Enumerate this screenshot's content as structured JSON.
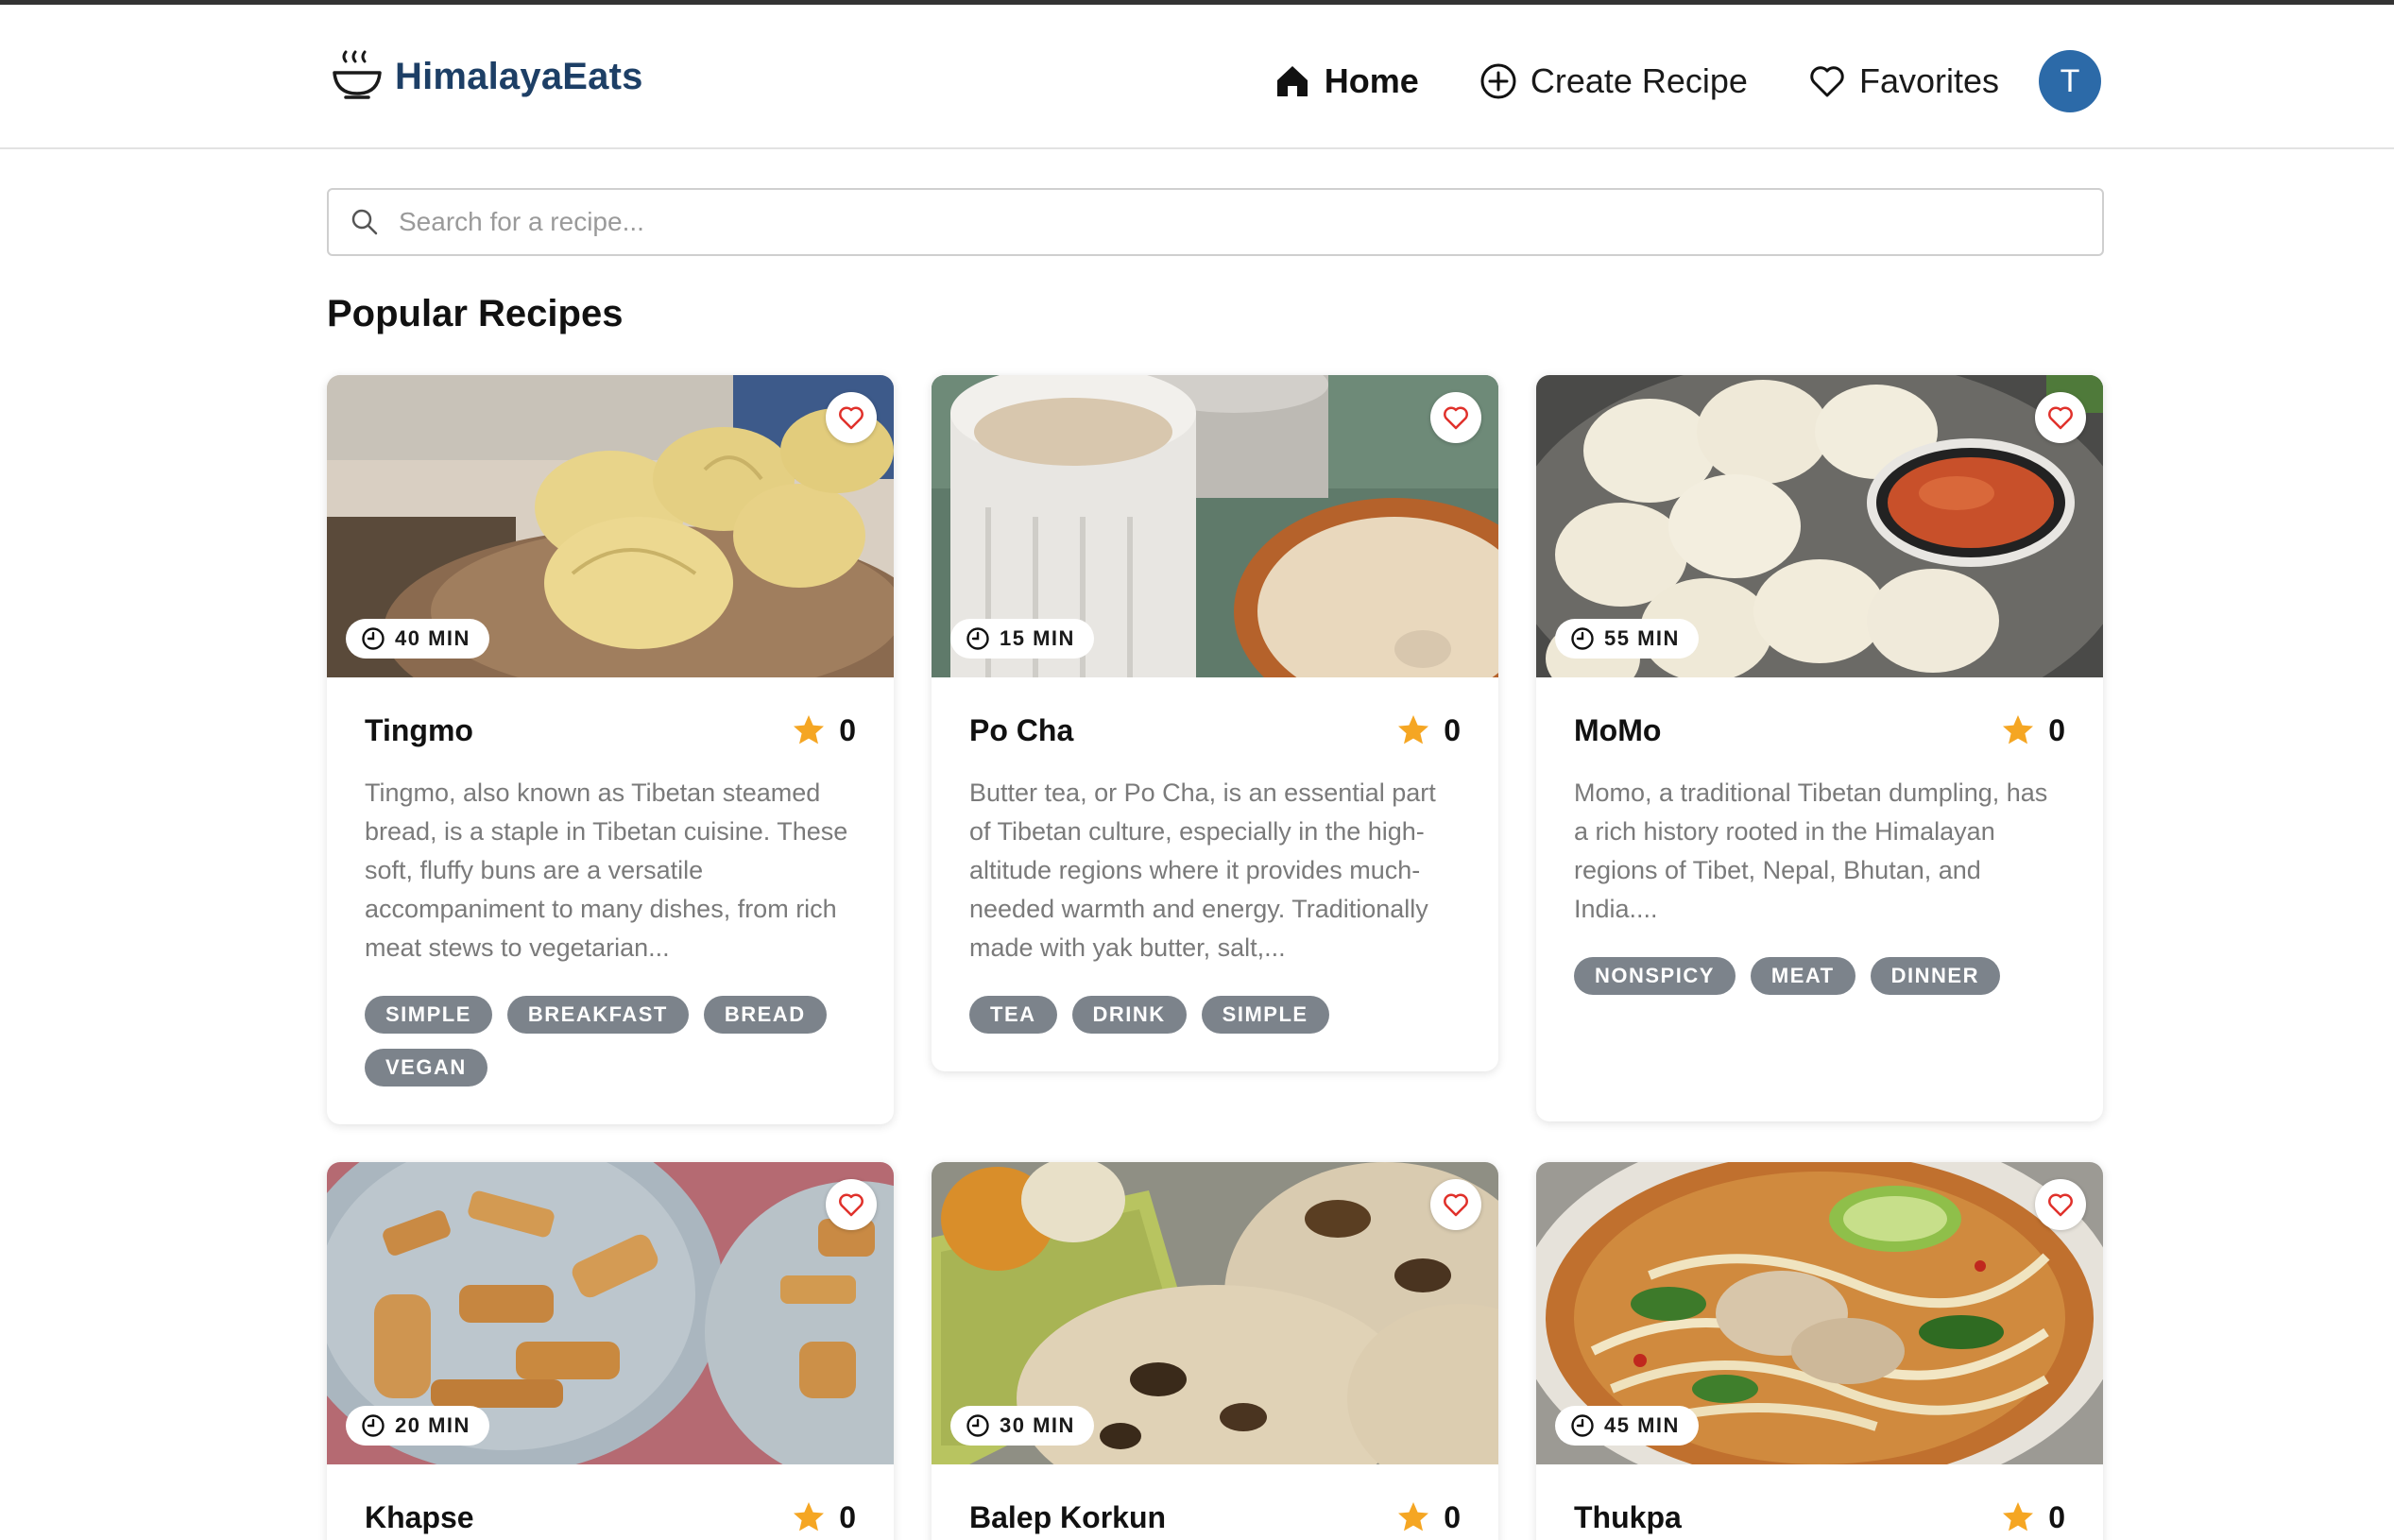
{
  "app": {
    "brand_name": "HimalayaEats",
    "brand_color": "#1d3f66",
    "accent_color": "#2c6aa8"
  },
  "nav": {
    "home_label": "Home",
    "create_label": "Create Recipe",
    "favorites_label": "Favorites",
    "avatar_initial": "T"
  },
  "search": {
    "placeholder": "Search for a recipe..."
  },
  "main": {
    "section_title": "Popular Recipes"
  },
  "recipes": [
    {
      "title": "Tingmo",
      "time": "40 MIN",
      "rating": "0",
      "description": "Tingmo, also known as Tibetan steamed bread, is a staple in Tibetan cuisine. These soft, fluffy buns are a versatile accompaniment to many dishes, from rich meat stews to vegetarian...",
      "tags": [
        "SIMPLE",
        "BREAKFAST",
        "BREAD",
        "VEGAN"
      ],
      "image": "steamed-buns-photo"
    },
    {
      "title": "Po Cha",
      "time": "15 MIN",
      "rating": "0",
      "description": "Butter tea, or Po Cha, is an essential part of Tibetan culture, especially in the high-altitude regions where it provides much-needed warmth and energy. Traditionally made with yak butter, salt,...",
      "tags": [
        "TEA",
        "DRINK",
        "SIMPLE"
      ],
      "image": "butter-tea-photo"
    },
    {
      "title": "MoMo",
      "time": "55 MIN",
      "rating": "0",
      "description": "Momo, a traditional Tibetan dumpling, has a rich history rooted in the Himalayan regions of Tibet, Nepal, Bhutan, and India....",
      "tags": [
        "NONSPICY",
        "MEAT",
        "DINNER"
      ],
      "image": "dumplings-photo"
    },
    {
      "title": "Khapse",
      "time": "20 MIN",
      "rating": "0",
      "description": "",
      "tags": [],
      "image": "fried-cookies-photo"
    },
    {
      "title": "Balep Korkun",
      "time": "30 MIN",
      "rating": "0",
      "description": "",
      "tags": [],
      "image": "flatbread-photo"
    },
    {
      "title": "Thukpa",
      "time": "45 MIN",
      "rating": "0",
      "description": "",
      "tags": [],
      "image": "noodle-soup-photo"
    }
  ]
}
